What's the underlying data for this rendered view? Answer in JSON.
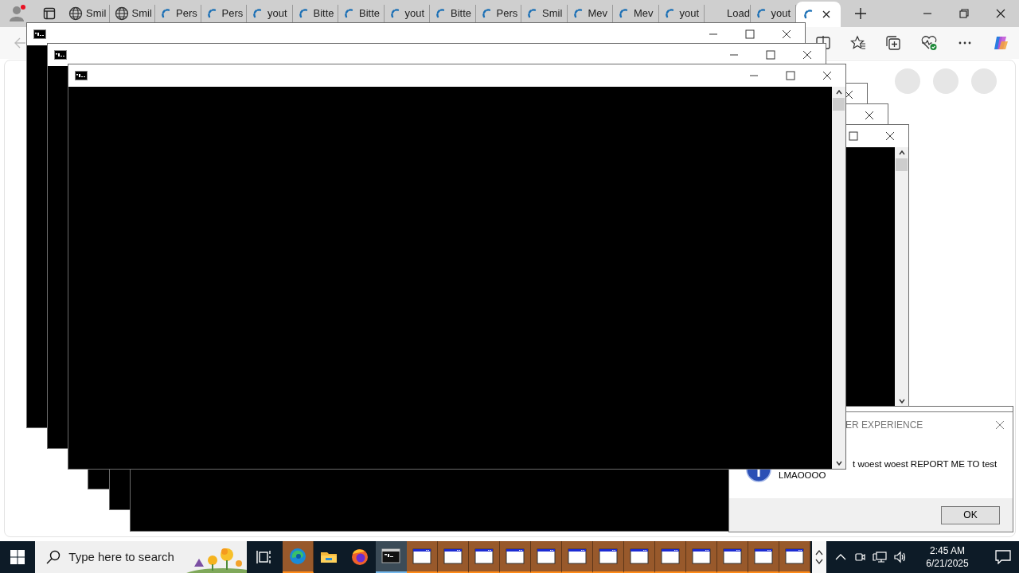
{
  "browser": {
    "tabs": [
      {
        "label": "Smil",
        "kind": "globe",
        "selected": false
      },
      {
        "label": "Smil",
        "kind": "globe",
        "selected": false
      },
      {
        "label": "Pers",
        "kind": "spinner",
        "selected": false
      },
      {
        "label": "Pers",
        "kind": "spinner",
        "selected": false
      },
      {
        "label": "yout",
        "kind": "spinner",
        "selected": false
      },
      {
        "label": "Bitte",
        "kind": "spinner",
        "selected": false
      },
      {
        "label": "Bitte",
        "kind": "spinner",
        "selected": false
      },
      {
        "label": "yout",
        "kind": "spinner",
        "selected": false
      },
      {
        "label": "Bitte",
        "kind": "spinner",
        "selected": false
      },
      {
        "label": "Pers",
        "kind": "spinner",
        "selected": false
      },
      {
        "label": "Smil",
        "kind": "spinner",
        "selected": false
      },
      {
        "label": "Mev",
        "kind": "spinner",
        "selected": false
      },
      {
        "label": "Mev",
        "kind": "spinner",
        "selected": false
      },
      {
        "label": "yout",
        "kind": "spinner",
        "selected": false
      },
      {
        "label": "Load",
        "kind": "blank",
        "selected": false
      },
      {
        "label": "yout",
        "kind": "spinner",
        "selected": false
      },
      {
        "kind": "spinner",
        "selected": true
      }
    ]
  },
  "dialog": {
    "title": "ER EXPERIENCE",
    "message_lines": [
      "t woest woest REPORT ME TO test",
      "LMAOOOO"
    ],
    "button": "OK"
  },
  "taskbar": {
    "search_placeholder": "Type here to search",
    "apps": [
      {
        "kind": "edge",
        "flashing": true,
        "selected": false
      },
      {
        "kind": "explorer",
        "flashing": false,
        "selected": false
      },
      {
        "kind": "firefox",
        "flashing": false,
        "selected": false
      },
      {
        "kind": "console",
        "flashing": false,
        "selected": true
      },
      {
        "kind": "window",
        "flashing": true,
        "selected": false
      },
      {
        "kind": "window",
        "flashing": true,
        "selected": false
      },
      {
        "kind": "window",
        "flashing": true,
        "selected": false
      },
      {
        "kind": "window",
        "flashing": true,
        "selected": false
      },
      {
        "kind": "window",
        "flashing": true,
        "selected": false
      },
      {
        "kind": "window",
        "flashing": true,
        "selected": false
      },
      {
        "kind": "window",
        "flashing": true,
        "selected": false
      },
      {
        "kind": "window",
        "flashing": true,
        "selected": false
      },
      {
        "kind": "window",
        "flashing": true,
        "selected": false
      },
      {
        "kind": "window",
        "flashing": true,
        "selected": false
      },
      {
        "kind": "window",
        "flashing": true,
        "selected": false
      },
      {
        "kind": "window",
        "flashing": true,
        "selected": false
      },
      {
        "kind": "window",
        "flashing": true,
        "selected": false
      }
    ],
    "time": "2:45 AM",
    "date": "6/21/2025"
  }
}
